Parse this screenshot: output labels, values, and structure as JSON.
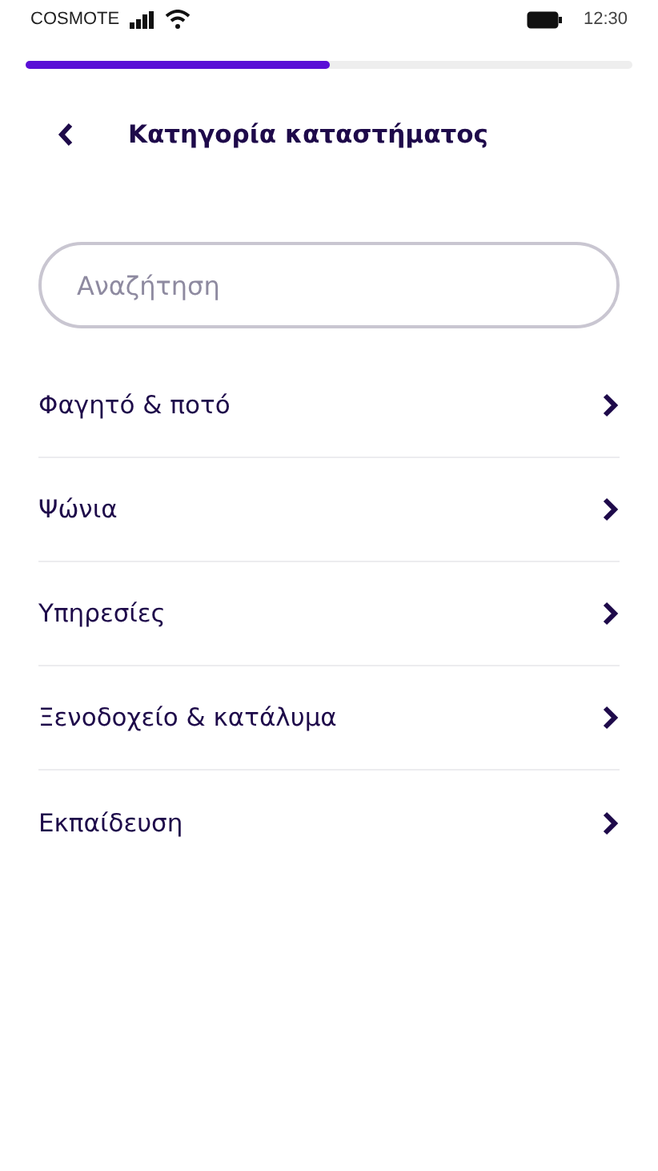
{
  "status_bar": {
    "carrier": "COSMOTE",
    "time": "12:30"
  },
  "progress": {
    "level": 0.5
  },
  "header": {
    "title": "Κατηγορία καταστήματος"
  },
  "search": {
    "placeholder": "Αναζήτηση"
  },
  "categories": [
    {
      "label": "Φαγητό & ποτό"
    },
    {
      "label": "Ψώνια"
    },
    {
      "label": "Υπηρεσίες"
    },
    {
      "label": "Ξενοδοχείο & κατάλυμα"
    },
    {
      "label": "Εκπαίδευση"
    }
  ]
}
